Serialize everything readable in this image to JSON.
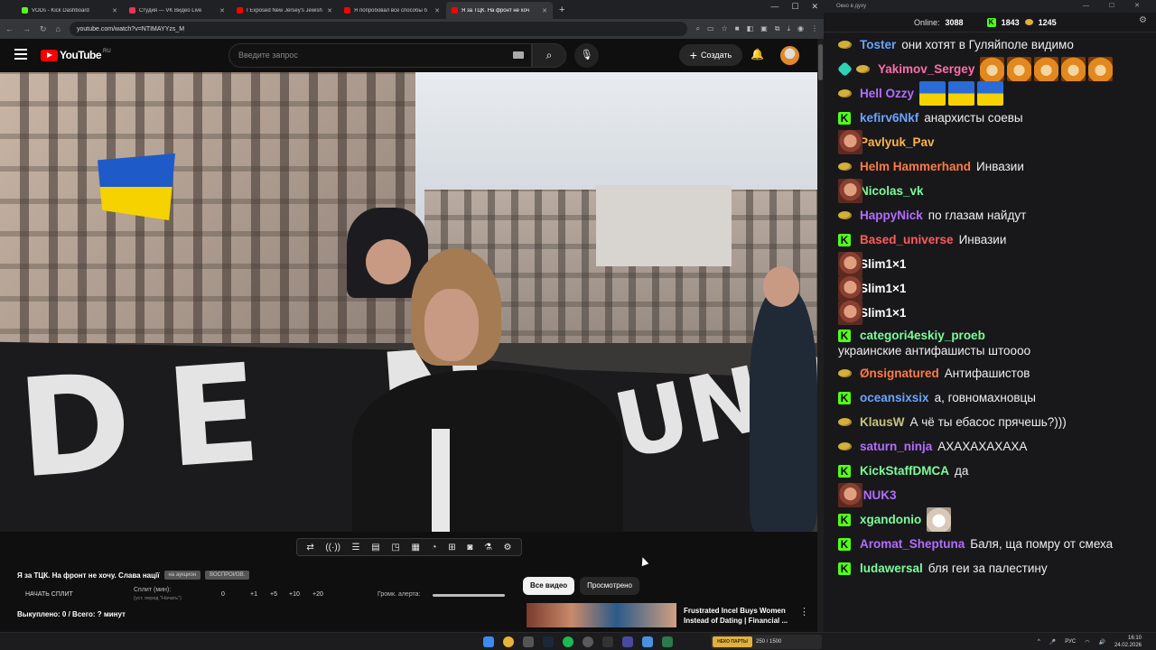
{
  "browser": {
    "tabs": [
      {
        "label": "VODs - Kick Dashboard",
        "color": "#53fc18",
        "active": false
      },
      {
        "label": "Студия — VK Видео Live",
        "color": "#e8345a",
        "active": false
      },
      {
        "label": "I Exposed New Jersey's Jewish",
        "color": "#ff0000",
        "active": false
      },
      {
        "label": "Я попробовал все способы б",
        "color": "#ff0000",
        "active": false
      },
      {
        "label": "Я за ТЦК. На фронт не хоч",
        "color": "#ff0000",
        "active": true
      }
    ],
    "url": "youtube.com/watch?v=NTIMAYYzs_M"
  },
  "youtube": {
    "logo_text": "YouTube",
    "region": "RU",
    "search_placeholder": "Введите запрос",
    "create_label": "Создать"
  },
  "video": {
    "banner_left": "DE N",
    "banner_right": "UNO"
  },
  "stream_panel": {
    "title": "Я за ТЦК. На фронт не хочу. Слава нації",
    "chip1": "на аукцион",
    "chip2": "ВОСПРОИЗВ.",
    "start_split": "НАЧАТЬ СПЛИТ",
    "split_label": "Сплит (мин):",
    "split_hint": "(уст. перед \"Начать\")",
    "split_value": "0",
    "inc1": "+1",
    "inc5": "+5",
    "inc10": "+10",
    "inc20": "+20",
    "alert_volume": "Громк. алерта:",
    "bought": "Выкуплено: 0 / Всего: ? минут"
  },
  "filters": {
    "all": "Все видео",
    "watched": "Просмотрено"
  },
  "recommendation": {
    "title": "Frustrated Incel Buys Women Instead of Dating | Financial ..."
  },
  "chat": {
    "window_title": "Окно в духу",
    "online_label": "Online:",
    "online_count": "3088",
    "kick_count": "1843",
    "coin_count": "1245",
    "messages": [
      {
        "user": "Toster",
        "color": "#6aa4ff",
        "badge": "coin",
        "text": "они хотят в Гуляйполе видимо",
        "emotes": []
      },
      {
        "user": "Yakimov_Sergey",
        "color": "#ff6fa8",
        "badge": "verified-coin",
        "text": "",
        "emotes": [
          "tiger",
          "tiger",
          "tiger",
          "tiger",
          "tiger"
        ]
      },
      {
        "user": "Hell Ozzy",
        "color": "#b46cff",
        "badge": "coin",
        "text": "",
        "emotes": [
          "uaflag",
          "uaflag",
          "uaflag"
        ]
      },
      {
        "user": "kefirv6Nkf",
        "color": "#6aa4ff",
        "badge": "k",
        "text": "анархисты соевы",
        "emotes": []
      },
      {
        "user": "Pavlyuk_Pav",
        "color": "#ffb347",
        "badge": "k",
        "text": "",
        "emotes": [
          "face"
        ]
      },
      {
        "user": "Helm Hammerhand",
        "color": "#ff7a45",
        "badge": "coin",
        "text": "Инвазии",
        "emotes": []
      },
      {
        "user": "Nicolas_vk",
        "color": "#7cfc9a",
        "badge": "k",
        "text": "",
        "emotes": [
          "face"
        ]
      },
      {
        "user": "HappyNick",
        "color": "#b46cff",
        "badge": "coin",
        "text": "по глазам найдут",
        "emotes": []
      },
      {
        "user": "Based_universe",
        "color": "#ff5b5b",
        "badge": "k",
        "text": "Инвазии",
        "emotes": []
      },
      {
        "user": "Slim1×1",
        "color": "#ffffff",
        "badge": "k",
        "text": "",
        "emotes": [
          "face"
        ]
      },
      {
        "user": "Slim1×1",
        "color": "#ffffff",
        "badge": "k",
        "text": "",
        "emotes": [
          "face"
        ]
      },
      {
        "user": "Slim1×1",
        "color": "#ffffff",
        "badge": "k",
        "text": "",
        "emotes": [
          "face"
        ]
      },
      {
        "user": "categori4eskiy_proeb",
        "color": "#7cfc9a",
        "badge": "k",
        "text": "украинские антифашисты штоооо",
        "emotes": []
      },
      {
        "user": "Ønsignatured",
        "color": "#ff7a45",
        "badge": "coin",
        "text": "Антифашистов",
        "emotes": []
      },
      {
        "user": "oceansixsix",
        "color": "#6aa4ff",
        "badge": "k",
        "text": "а, говномахновцы",
        "emotes": []
      },
      {
        "user": "KlausW",
        "color": "#c8c47a",
        "badge": "coin",
        "text": "А чё ты ебасос прячешь?)))",
        "emotes": []
      },
      {
        "user": "saturn_ninja",
        "color": "#b46cff",
        "badge": "coin",
        "text": "АХАХАХАХАХА",
        "emotes": []
      },
      {
        "user": "KickStaffDMCA",
        "color": "#7cfc9a",
        "badge": "k",
        "text": "да",
        "emotes": []
      },
      {
        "user": "iNUK3",
        "color": "#b46cff",
        "badge": "k",
        "text": "",
        "emotes": [
          "face"
        ]
      },
      {
        "user": "xgandonio",
        "color": "#7cfc9a",
        "badge": "k",
        "text": "",
        "emotes": [
          "cat"
        ]
      },
      {
        "user": "Aromat_Sheptuna",
        "color": "#b46cff",
        "badge": "k",
        "text": "Баля, ща помру от смеха",
        "emotes": []
      },
      {
        "user": "ludawersal",
        "color": "#7cfc9a",
        "badge": "k",
        "text": "бля геи за палестину",
        "emotes": []
      }
    ]
  },
  "taskbar": {
    "tray_label": "НЕКО ПАРТЫ",
    "tray_value": "250 / 1500",
    "lang": "РУС",
    "time": "16:10",
    "date": "24.02.2026"
  }
}
